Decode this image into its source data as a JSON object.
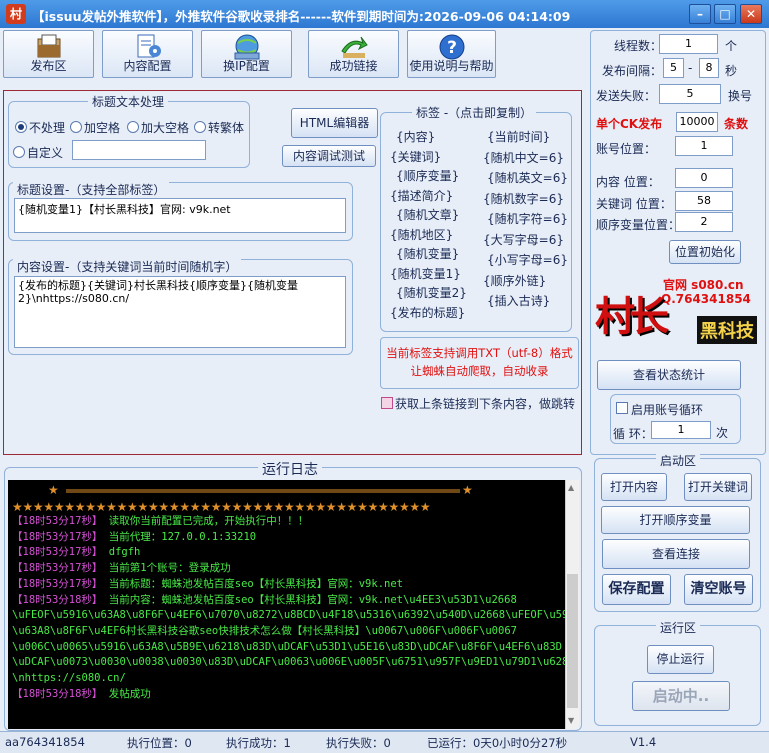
{
  "app": {
    "icon_char": "村",
    "title": "【issuu发帖外推软件】，外推软件谷歌收录排名------软件到期时间为:2026-09-06 04:14:09"
  },
  "toolbar": [
    {
      "label": "发布区"
    },
    {
      "label": "内容配置"
    },
    {
      "label": "换IP配置"
    },
    {
      "label": "成功链接"
    },
    {
      "label": "使用说明与帮助"
    }
  ],
  "title_processing": {
    "group_label": "标题文本处理",
    "options": [
      "不处理",
      "加空格",
      "加大空格",
      "转繁体"
    ],
    "custom_label": "自定义",
    "custom_value": "",
    "selected": "不处理"
  },
  "buttons": {
    "html_editor": "HTML编辑器",
    "content_test": "内容调试测试",
    "view_stats": "查看状态统计",
    "reset_position": "位置初始化",
    "open_content": "打开内容",
    "open_keywords": "打开关键词",
    "open_order": "打开顺序变量",
    "view_links": "查看连接",
    "save_config": "保存配置",
    "clear_accounts": "清空账号",
    "stop_run": "停止运行",
    "starting": "启动中.."
  },
  "title_setting": {
    "label": "标题设置-（支持全部标签）",
    "value": "{随机变量1}【村长黑科技】官网: v9k.net"
  },
  "content_setting": {
    "label": "内容设置-（支持关键词当前时间随机字）",
    "value_line1": "{发布的标题}{关键词}村长黑科技{顺序变量}{随机变量",
    "value_line2": "2}\\nhttps://s080.cn/"
  },
  "tags": {
    "label": "标签 -（点击即复制）",
    "left": [
      "{内容}",
      "{关键词}",
      "{顺序变量}",
      "{描述简介}",
      "{随机文章}",
      "{随机地区}",
      "{随机变量}",
      "{随机变量1}",
      "{随机变量2}",
      "{发布的标题}"
    ],
    "right": [
      "{当前时间}",
      "{随机中文=6}",
      "{随机英文=6}",
      "{随机数字=6}",
      "{随机字符=6}",
      "{大写字母=6}",
      "{小写字母=6}",
      "{顺序外链}",
      "{插入古诗}"
    ]
  },
  "notice": {
    "line1": "当前标签支持调用TXT（utf-8）格式",
    "line2": "让蜘蛛自动爬取，自动收录"
  },
  "chain_checkbox": "获取上条链接到下条内容，做跳转",
  "log": {
    "label": "运行日志",
    "lines": [
      {
        "ts": "【18时53分17秒】",
        "msg": "读取你当前配置已完成，开始执行中！！！"
      },
      {
        "ts": "【18时53分17秒】",
        "msg": "当前代理：127.0.0.1:33210"
      },
      {
        "ts": "【18时53分17秒】",
        "msg": "dfgfh"
      },
      {
        "ts": "【18时53分17秒】",
        "msg": "当前第1个账号：登录成功"
      },
      {
        "ts": "【18时53分17秒】",
        "msg": "当前标题：蜘蛛池发帖百度seo【村长黑科技】官网：v9k.net"
      },
      {
        "ts": "【18时53分18秒】",
        "msg": "当前内容：蜘蛛池发帖百度seo【村长黑科技】官网：v9k.net\\u4EE3\\u53D1\\u2668"
      },
      {
        "ts": "",
        "msg": "\\uFEOF\\u5916\\u63A8\\u8F6F\\u4EF6\\u7070\\u8272\\u8BCD\\u4F18\\u5316\\u6392\\u540D\\u2668\\uFEOF\\u5916"
      },
      {
        "ts": "",
        "msg": "\\u63A8\\u8F6F\\u4EF6村长黑科技谷歌seo快排技术怎么做【村长黑科技】\\u0067\\u006F\\u006F\\u0067"
      },
      {
        "ts": "",
        "msg": "\\u006C\\u0065\\u5916\\u63A8\\u5B9E\\u6218\\u83D\\uDCAF\\u53D1\\u5E16\\u83D\\uDCAF\\u8F6F\\u4EF6\\u83D"
      },
      {
        "ts": "",
        "msg": "\\uDCAF\\u0073\\u0030\\u0038\\u0030\\u83D\\uDCAF\\u0063\\u006E\\u005F\\u6751\\u957F\\u9ED1\\u79D1\\u6280"
      },
      {
        "ts": "",
        "msg": "\\nhttps://s080.cn/"
      },
      {
        "ts": "【18时53分18秒】",
        "msg": "发帖成功"
      }
    ]
  },
  "right_panel": {
    "threads_label": "线程数：",
    "threads_value": "1",
    "threads_unit": "个",
    "interval_label": "发布间隔：",
    "interval_min": "5",
    "interval_dash": "-",
    "interval_max": "8",
    "interval_unit": "秒",
    "fail_label": "发送失败：",
    "fail_value": "5",
    "fail_unit": "换号",
    "ck_label": "单个CK发布",
    "ck_value": "10000",
    "ck_unit": "条数",
    "account_pos_label": "账号位置：",
    "account_pos_value": "1",
    "content_pos_label": "内容 位置：",
    "content_pos_value": "0",
    "keyword_pos_label": "关键词 位置：",
    "keyword_pos_value": "58",
    "order_pos_label": "顺序变量位置：",
    "order_pos_value": "2",
    "logo_site": "官网 s080.cn",
    "logo_qq": "Q.764341854",
    "logo_main": "村长",
    "logo_sub": "黑科技",
    "loop_label": "启用账号循环",
    "loop_count_label": "循 环：",
    "loop_count_value": "1",
    "loop_count_unit": "次",
    "launch_label": "启动区",
    "run_label": "运行区"
  },
  "statusbar": {
    "account": "aa764341854",
    "exec_pos": "执行位置：0",
    "exec_success": "执行成功：1",
    "exec_fail": "执行失败：0",
    "elapsed": "已运行：0天0小时0分27秒",
    "version": "V1.4"
  },
  "colors": {
    "accent_red": "#e01010",
    "log_time": "#d451d4",
    "log_msg": "#48e948"
  }
}
